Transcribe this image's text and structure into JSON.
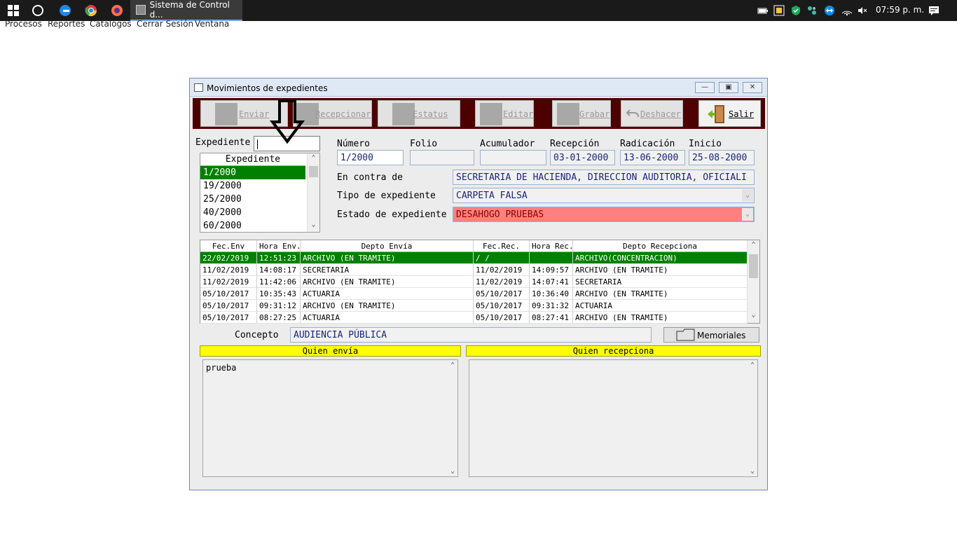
{
  "taskbar": {
    "task_title": "Sistema de Control d...",
    "clock": "07:59 p. m."
  },
  "menu": [
    "Procesos",
    "Reportes",
    "Catálogos",
    "Cerrar Sesión",
    "Ventana"
  ],
  "window": {
    "title": "Movimientos de expedientes"
  },
  "toolbar": {
    "enviar": "Enviar",
    "recepcionar": "Recepcionar",
    "estatus": "Estatus",
    "editar": "Editar",
    "grabar": "Grabar",
    "deshacer": "Deshacer",
    "salir": "Salir"
  },
  "expediente": {
    "label": "Expediente",
    "input_value": "",
    "list_header": "Expediente",
    "items": [
      "1/2000",
      "19/2000",
      "25/2000",
      "40/2000",
      "60/2000"
    ]
  },
  "fields": {
    "numero_label": "Número",
    "numero": "1/2000",
    "folio_label": "Folio",
    "folio": "",
    "acumulador_label": "Acumulador",
    "acumulador": "",
    "recepcion_label": "Recepción",
    "recepcion": "03-01-2000",
    "radicacion_label": "Radicación",
    "radicacion": "13-06-2000",
    "inicio_label": "Inicio",
    "inicio": "25-08-2000",
    "en_contra_label": "En contra de",
    "en_contra": "SECRETARIA DE HACIENDA, DIRECCION AUDITORIA, OFICIALI",
    "tipo_label": "Tipo de expediente",
    "tipo": "CARPETA FALSA",
    "estado_label": "Estado de expediente",
    "estado": "DESAHOGO PRUEBAS"
  },
  "grid": {
    "headers": [
      "Fec.Env",
      "Hora Env.",
      "Depto Envía",
      "Fec.Rec.",
      "Hora Rec.",
      "Depto Recepciona"
    ],
    "rows": [
      [
        "22/02/2019",
        "12:51:23",
        "ARCHIVO (EN TRAMITE)",
        "/  /",
        "",
        "ARCHIVO(CONCENTRACION)"
      ],
      [
        "11/02/2019",
        "14:08:17",
        "SECRETARIA",
        "11/02/2019",
        "14:09:57",
        "ARCHIVO (EN TRAMITE)"
      ],
      [
        "11/02/2019",
        "11:42:06",
        "ARCHIVO (EN TRAMITE)",
        "11/02/2019",
        "14:07:41",
        "SECRETARIA"
      ],
      [
        "05/10/2017",
        "10:35:43",
        "ACTUARIA",
        "05/10/2017",
        "10:36:40",
        "ARCHIVO (EN TRAMITE)"
      ],
      [
        "05/10/2017",
        "09:31:12",
        "ARCHIVO (EN TRAMITE)",
        "05/10/2017",
        "09:31:32",
        "ACTUARIA"
      ],
      [
        "05/10/2017",
        "08:27:25",
        "ACTUARIA",
        "05/10/2017",
        "08:27:41",
        "ARCHIVO (EN TRAMITE)"
      ]
    ]
  },
  "concepto": {
    "label": "Concepto",
    "value": "AUDIENCIA PÚBLICA",
    "memoriales": "Memoriales"
  },
  "quien_envia": {
    "header": "Quien envía",
    "text": "prueba"
  },
  "quien_recepciona": {
    "header": "Quien recepciona",
    "text": ""
  },
  "colors": {
    "selection": "#008000",
    "toolbar_bg": "#4d0000",
    "estado_bg": "#ff8080",
    "header_yellow": "#ffff00"
  }
}
